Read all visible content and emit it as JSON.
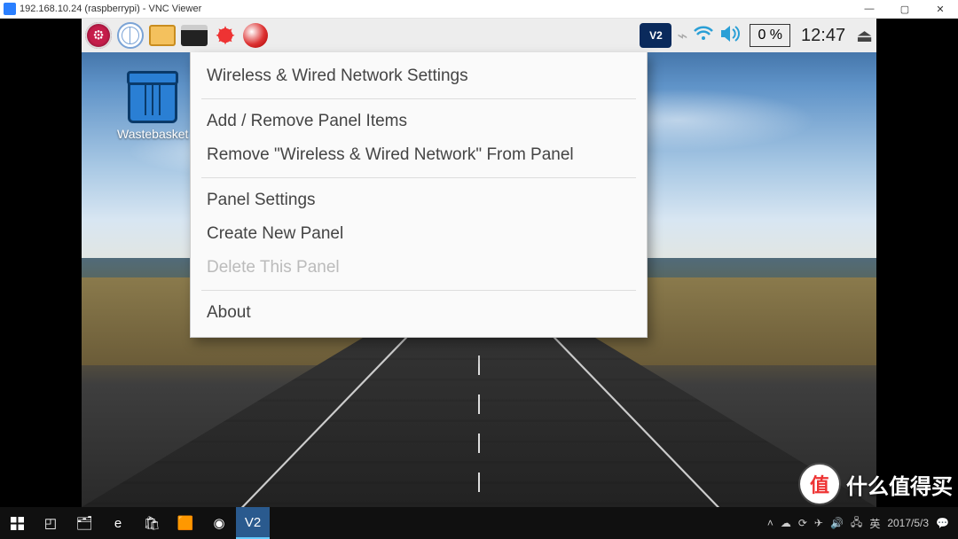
{
  "vnc_window": {
    "title": "192.168.10.24 (raspberrypi) - VNC Viewer",
    "minimize": "—",
    "maximize": "▢",
    "close": "✕"
  },
  "pi_panel": {
    "vnc_badge": "V2",
    "cpu_pct": "0 %",
    "clock": "12:47"
  },
  "desktop": {
    "wastebasket_label": "Wastebasket"
  },
  "context_menu": {
    "item1": "Wireless & Wired Network Settings",
    "item2": "Add / Remove Panel Items",
    "item3": "Remove \"Wireless & Wired Network\" From Panel",
    "item4": "Panel Settings",
    "item5": "Create New Panel",
    "item6": "Delete This Panel",
    "item7": "About"
  },
  "taskbar": {
    "datetime_date": "2017/5/3"
  },
  "watermark": {
    "circle": "值",
    "text": "什么值得买"
  }
}
